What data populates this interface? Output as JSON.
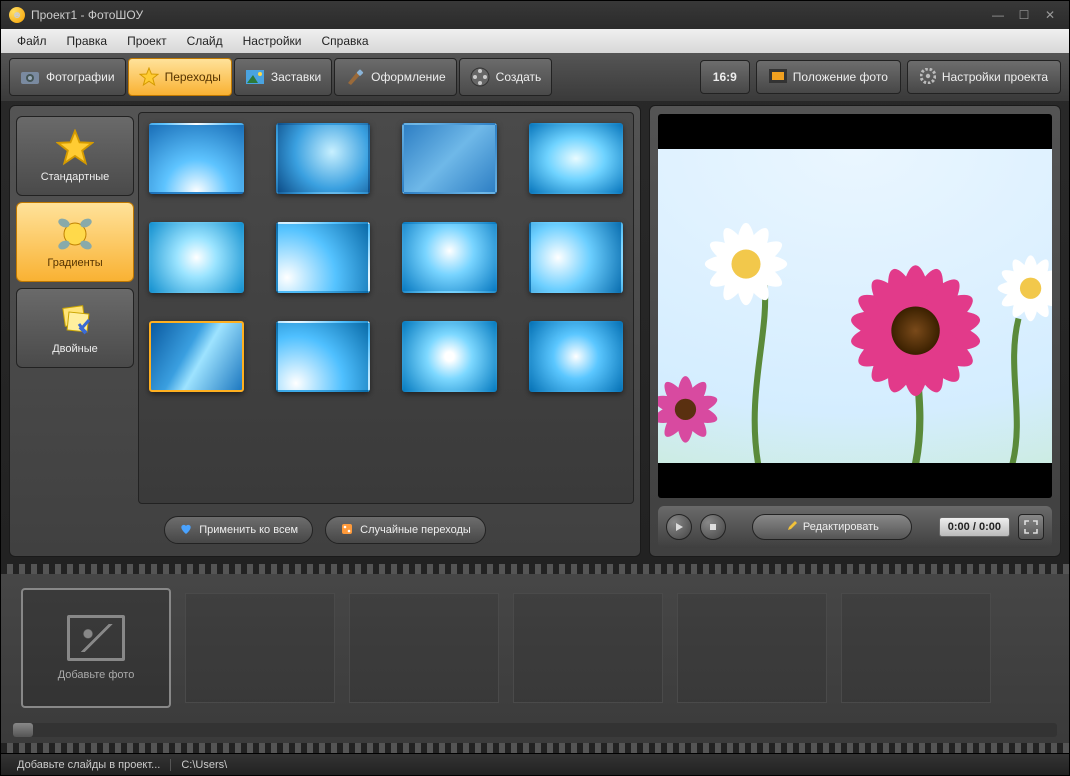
{
  "app": {
    "title": "Проект1 - ФотоШОУ"
  },
  "menu": {
    "file": "Файл",
    "edit": "Правка",
    "project": "Проект",
    "slide": "Слайд",
    "settings": "Настройки",
    "help": "Справка"
  },
  "tabs": {
    "photos": "Фотографии",
    "transitions": "Переходы",
    "templates": "Заставки",
    "decor": "Оформление",
    "create": "Создать"
  },
  "toolbar": {
    "aspect": "16:9",
    "photo_position": "Положение фото",
    "project_settings": "Настройки проекта"
  },
  "categories": {
    "standard": "Стандартные",
    "gradients": "Градиенты",
    "double": "Двойные"
  },
  "actions": {
    "apply_all": "Применить ко всем",
    "random": "Случайные переходы"
  },
  "preview": {
    "edit": "Редактировать",
    "time": "0:00 / 0:00"
  },
  "timeline": {
    "add_photo": "Добавьте фото"
  },
  "status": {
    "hint": "Добавьте слайды в проект...",
    "path": "C:\\Users\\"
  },
  "thumbs_count": 12,
  "selected_thumb": 8
}
